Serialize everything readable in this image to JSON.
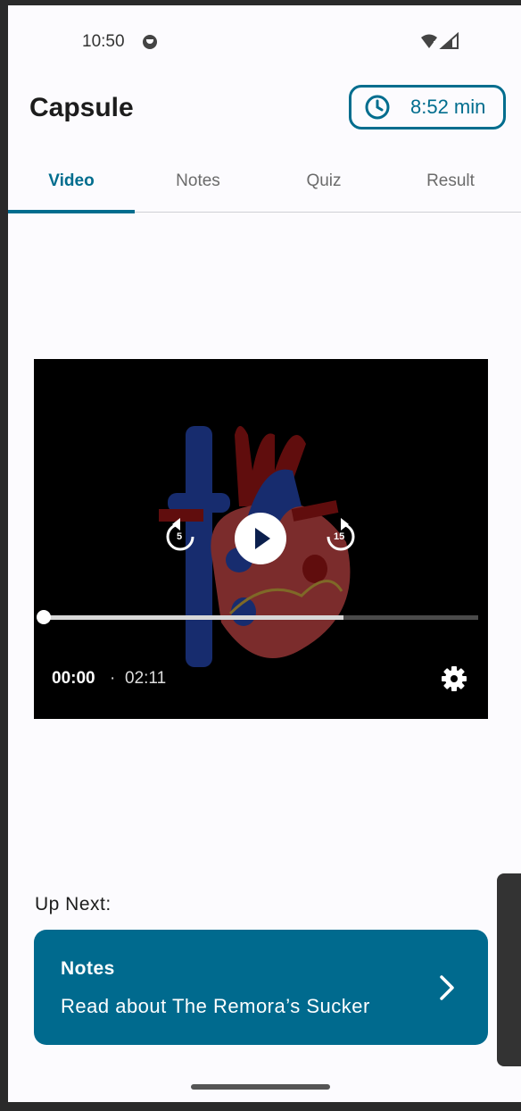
{
  "status_bar": {
    "time": "10:50"
  },
  "header": {
    "title": "Capsule",
    "timer": "8:52 min",
    "timer_icon": "clock-icon"
  },
  "tabs": [
    {
      "label": "Video",
      "active": true
    },
    {
      "label": "Notes",
      "active": false
    },
    {
      "label": "Quiz",
      "active": false
    },
    {
      "label": "Result",
      "active": false
    }
  ],
  "player": {
    "rewind_seconds": "5",
    "forward_seconds": "15",
    "current_time": "00:00",
    "separator": "·",
    "duration": "02:11",
    "buffered_fraction": 0.69,
    "played_fraction": 0.0
  },
  "up_next": {
    "label": "Up Next:",
    "card_title": "Notes",
    "card_subtitle": "Read about The Remora’s Sucker"
  },
  "colors": {
    "accent": "#006d8e",
    "card": "#006a8e",
    "background": "#fcfbfe"
  }
}
